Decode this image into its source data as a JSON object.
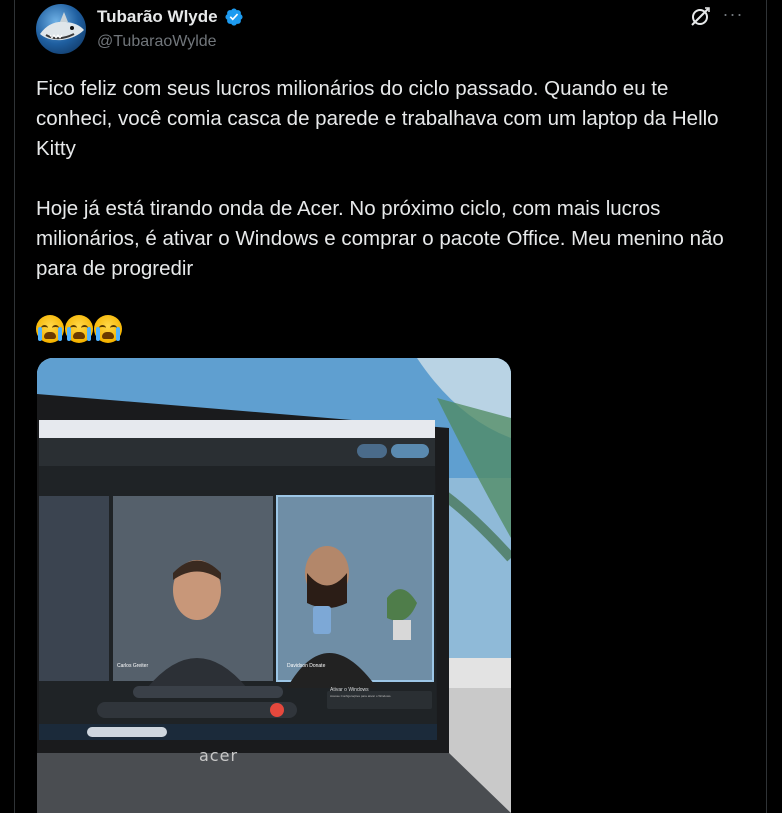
{
  "author": {
    "display_name": "Tubarão Wlyde",
    "handle": "@TubaraoWylde",
    "verified_icon": "verified-badge-icon",
    "avatar_icon": "shark-avatar"
  },
  "actions": {
    "grok_icon": "grok-icon",
    "more_icon": "more-options-icon",
    "more_glyph": "···"
  },
  "tweet": {
    "paragraph1": "Fico feliz com seus lucros milionários do ciclo passado. Quando eu te conheci, você comia casca de parede e trabalhava com um laptop da Hello Kitty",
    "paragraph2": "Hoje já está tirando onda de Acer. No próximo ciclo, com mais lucros milionários, é ativar o Windows e comprar o pacote Office. Meu menino não para de progredir",
    "emojis": [
      "😭",
      "😭",
      "😭"
    ]
  },
  "media": {
    "description_icon": "photo",
    "laptop_brand": "acer",
    "participant1": "Carlos Greiter",
    "participant2": "Davidson Donate",
    "watermark_line1": "Ativar o Windows",
    "watermark_line2": "Acesse Configurações para ativar o Windows."
  },
  "colors": {
    "background": "#000000",
    "text": "#e7e9ea",
    "secondary_text": "#71767b",
    "verified": "#1d9bf0",
    "border": "#2f3336"
  }
}
